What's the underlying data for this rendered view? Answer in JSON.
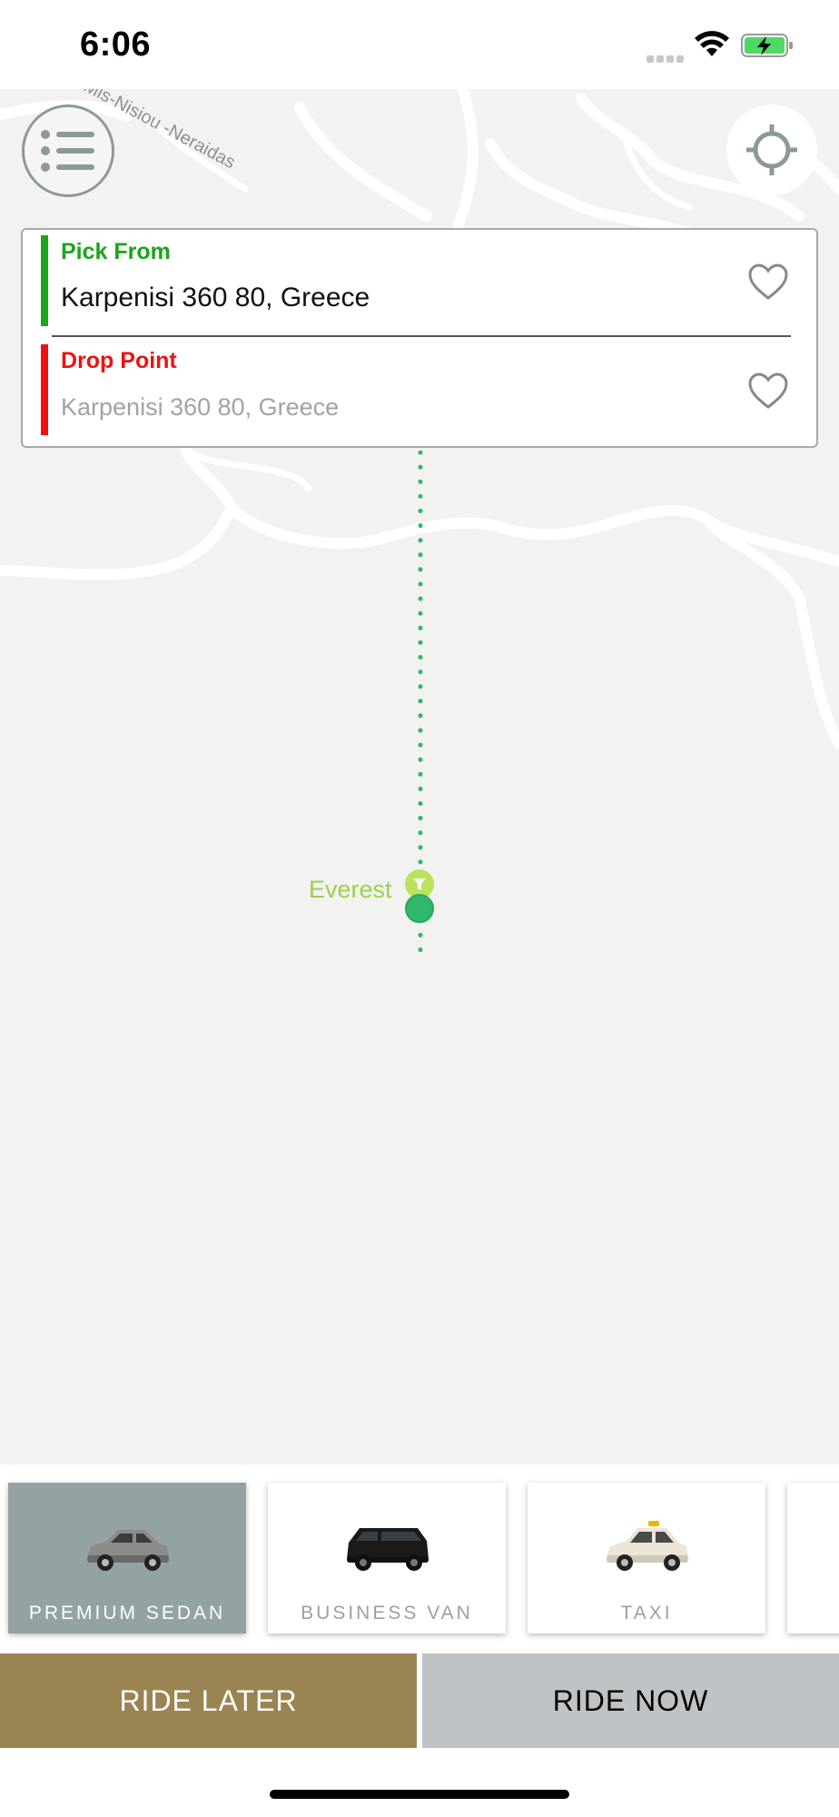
{
  "status_bar": {
    "time": "6:06",
    "icons": [
      "cellular-signal-icon",
      "wifi-icon",
      "battery-charging-icon"
    ]
  },
  "map": {
    "street_label": "Mis-Nisiou -Neraidas",
    "poi_label": "Everest",
    "menu_icon": "list-menu-icon",
    "locate_icon": "crosshair-location-icon"
  },
  "address": {
    "pick": {
      "label": "Pick From",
      "value": "Karpenisi 360 80, Greece",
      "icon": "heart-icon"
    },
    "drop": {
      "label": "Drop Point",
      "value": "Karpenisi 360 80, Greece",
      "icon": "heart-icon"
    }
  },
  "vehicles": [
    {
      "label": "PREMIUM SEDAN",
      "selected": true,
      "color": "#93a3a3"
    },
    {
      "label": "BUSINESS VAN",
      "selected": false
    },
    {
      "label": "TAXI",
      "selected": false
    }
  ],
  "actions": {
    "ride_later": "RIDE LATER",
    "ride_now": "RIDE NOW"
  },
  "colors": {
    "pick_accent": "#1aa51a",
    "drop_accent": "#ee1111",
    "ride_later_bg": "#9a8552",
    "ride_now_bg": "#bfc3c6",
    "route": "#2fb86a"
  }
}
